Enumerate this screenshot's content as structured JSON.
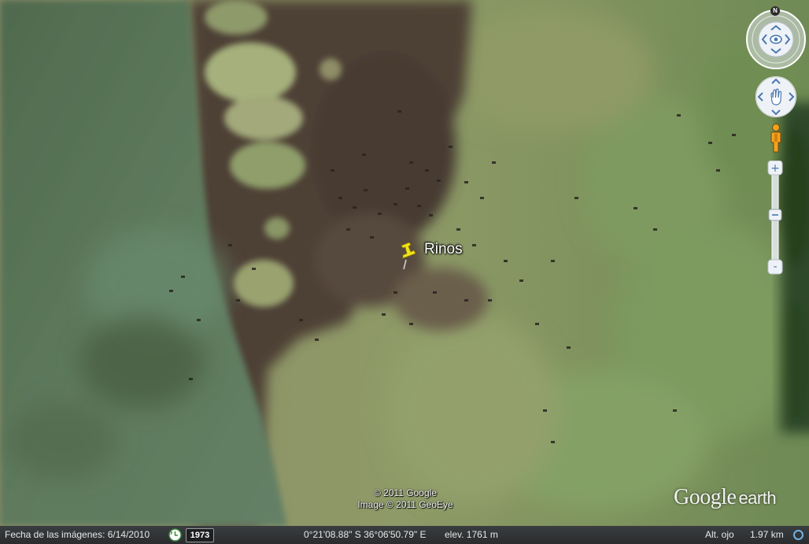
{
  "placemark": {
    "label": "Rinos",
    "icon": "yellow-pushpin-icon",
    "color": "#f2e21a"
  },
  "credits": {
    "line1": "© 2011 Google",
    "line2": "Image © 2011 GeoEye"
  },
  "brand": {
    "google": "Google",
    "earth": "earth"
  },
  "controls": {
    "compass_north": "N",
    "look_icon": "eye-icon",
    "move_icon": "hand-icon",
    "street_view_icon": "pegman-icon",
    "zoom_in": "+",
    "zoom_out": "-"
  },
  "status": {
    "imagery_date": "Fecha de las imágenes: 6/14/2010",
    "year": "1973",
    "coordinates": "0°21'08.88\" S   36°06'50.79\" E",
    "elevation": "elev.   1761 m",
    "eye_alt_label": "Alt. ojo",
    "eye_alt_value": "1.97 km"
  },
  "colors": {
    "water": "#5f7a5c",
    "mud": "#4c4038",
    "grass": "#8a9a63",
    "status_bar": "#2f3133"
  }
}
